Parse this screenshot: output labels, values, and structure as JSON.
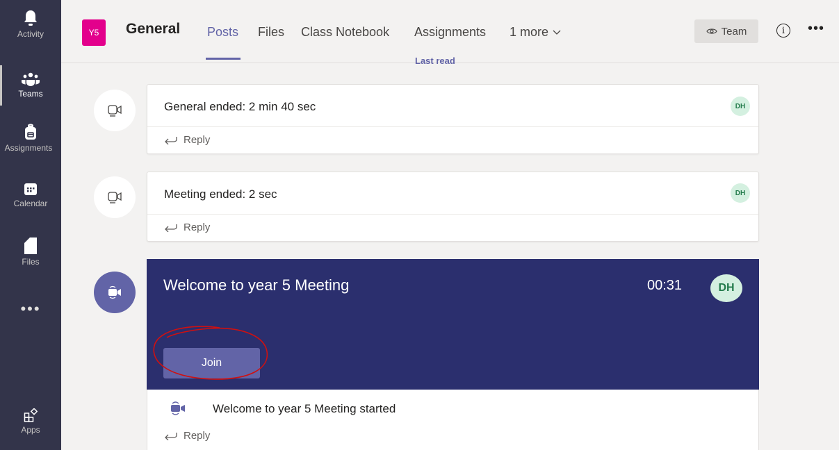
{
  "rail": {
    "items": [
      {
        "label": "Activity",
        "icon": "bell-icon"
      },
      {
        "label": "Teams",
        "icon": "teams-icon"
      },
      {
        "label": "Assignments",
        "icon": "backpack-icon"
      },
      {
        "label": "Calendar",
        "icon": "calendar-icon"
      },
      {
        "label": "Files",
        "icon": "file-icon"
      },
      {
        "label": "Apps",
        "icon": "apps-icon"
      }
    ],
    "more": "•••"
  },
  "header": {
    "team_avatar": "Y5",
    "channel": "General",
    "tabs": [
      "Posts",
      "Files",
      "Class Notebook",
      "Assignments",
      "1 more"
    ],
    "team_button": "Team"
  },
  "last_read": "Last read",
  "posts": [
    {
      "text": "General ended: 2 min 40 sec",
      "badge": "DH",
      "reply": "Reply"
    },
    {
      "text": "Meeting ended: 2 sec",
      "badge": "DH",
      "reply": "Reply"
    }
  ],
  "meeting": {
    "title": "Welcome to year 5 Meeting",
    "time": "00:31",
    "badge": "DH",
    "join_label": "Join",
    "started_text": "Welcome to year 5 Meeting started",
    "reply": "Reply"
  },
  "colors": {
    "rail": "#33344a",
    "accent": "#6264a7",
    "meeting_card": "#2b2f6e",
    "team_avatar": "#e3008c",
    "annotation": "#d01010"
  }
}
